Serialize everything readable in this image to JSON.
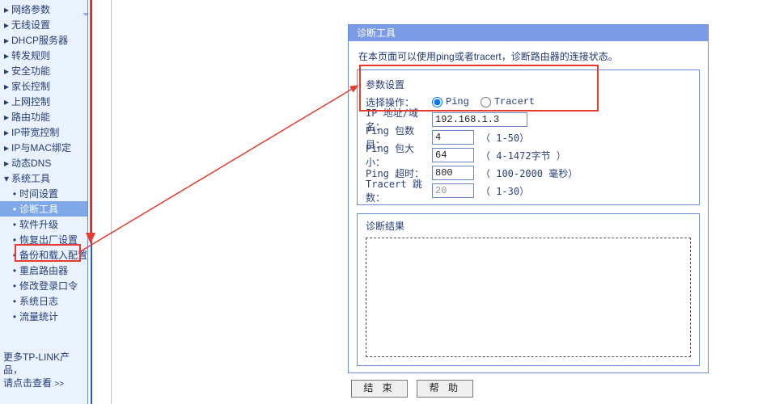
{
  "sidebar": {
    "items": [
      {
        "label": "网络参数",
        "type": "cat"
      },
      {
        "label": "无线设置",
        "type": "cat"
      },
      {
        "label": "DHCP服务器",
        "type": "cat"
      },
      {
        "label": "转发规则",
        "type": "cat"
      },
      {
        "label": "安全功能",
        "type": "cat"
      },
      {
        "label": "家长控制",
        "type": "cat"
      },
      {
        "label": "上网控制",
        "type": "cat"
      },
      {
        "label": "路由功能",
        "type": "cat"
      },
      {
        "label": "IP带宽控制",
        "type": "cat"
      },
      {
        "label": "IP与MAC绑定",
        "type": "cat"
      },
      {
        "label": "动态DNS",
        "type": "cat"
      },
      {
        "label": "系统工具",
        "type": "cat-open"
      },
      {
        "label": "时间设置",
        "type": "sub"
      },
      {
        "label": "诊断工具",
        "type": "sub",
        "active": true
      },
      {
        "label": "软件升级",
        "type": "sub"
      },
      {
        "label": "恢复出厂设置",
        "type": "sub"
      },
      {
        "label": "备份和载入配置",
        "type": "sub"
      },
      {
        "label": "重启路由器",
        "type": "sub"
      },
      {
        "label": "修改登录口令",
        "type": "sub"
      },
      {
        "label": "系统日志",
        "type": "sub"
      },
      {
        "label": "流量统计",
        "type": "sub"
      }
    ],
    "footer1": "更多TP-LINK产品，",
    "footer2": "请点击查看",
    "footer_arrow": ">>"
  },
  "panel": {
    "title": "诊断工具",
    "intro": "在本页面可以使用ping或者tracert，诊断路由器的连接状态。",
    "group_label": "参数设置",
    "op_label": "选择操作：",
    "radio": {
      "ping": "Ping",
      "tracert": "Tracert",
      "selected": "ping"
    },
    "ip_label": "IP 地址/域名：",
    "ip_value": "192.168.1.3",
    "count_label": "Ping 包数目：",
    "count_value": "4",
    "count_hint": "（ 1-50）",
    "size_label": "Ping 包大小：",
    "size_value": "64",
    "size_hint": "（ 4-1472字节 ）",
    "timeout_label": "Ping 超时：",
    "timeout_value": "800",
    "timeout_hint": "（ 100-2000 毫秒）",
    "hops_label": "Tracert 跳数：",
    "hops_value": "20",
    "hops_hint": "（ 1-30）",
    "result_title": "诊断结果",
    "btn_start": "结 束",
    "btn_help": "帮 助"
  }
}
